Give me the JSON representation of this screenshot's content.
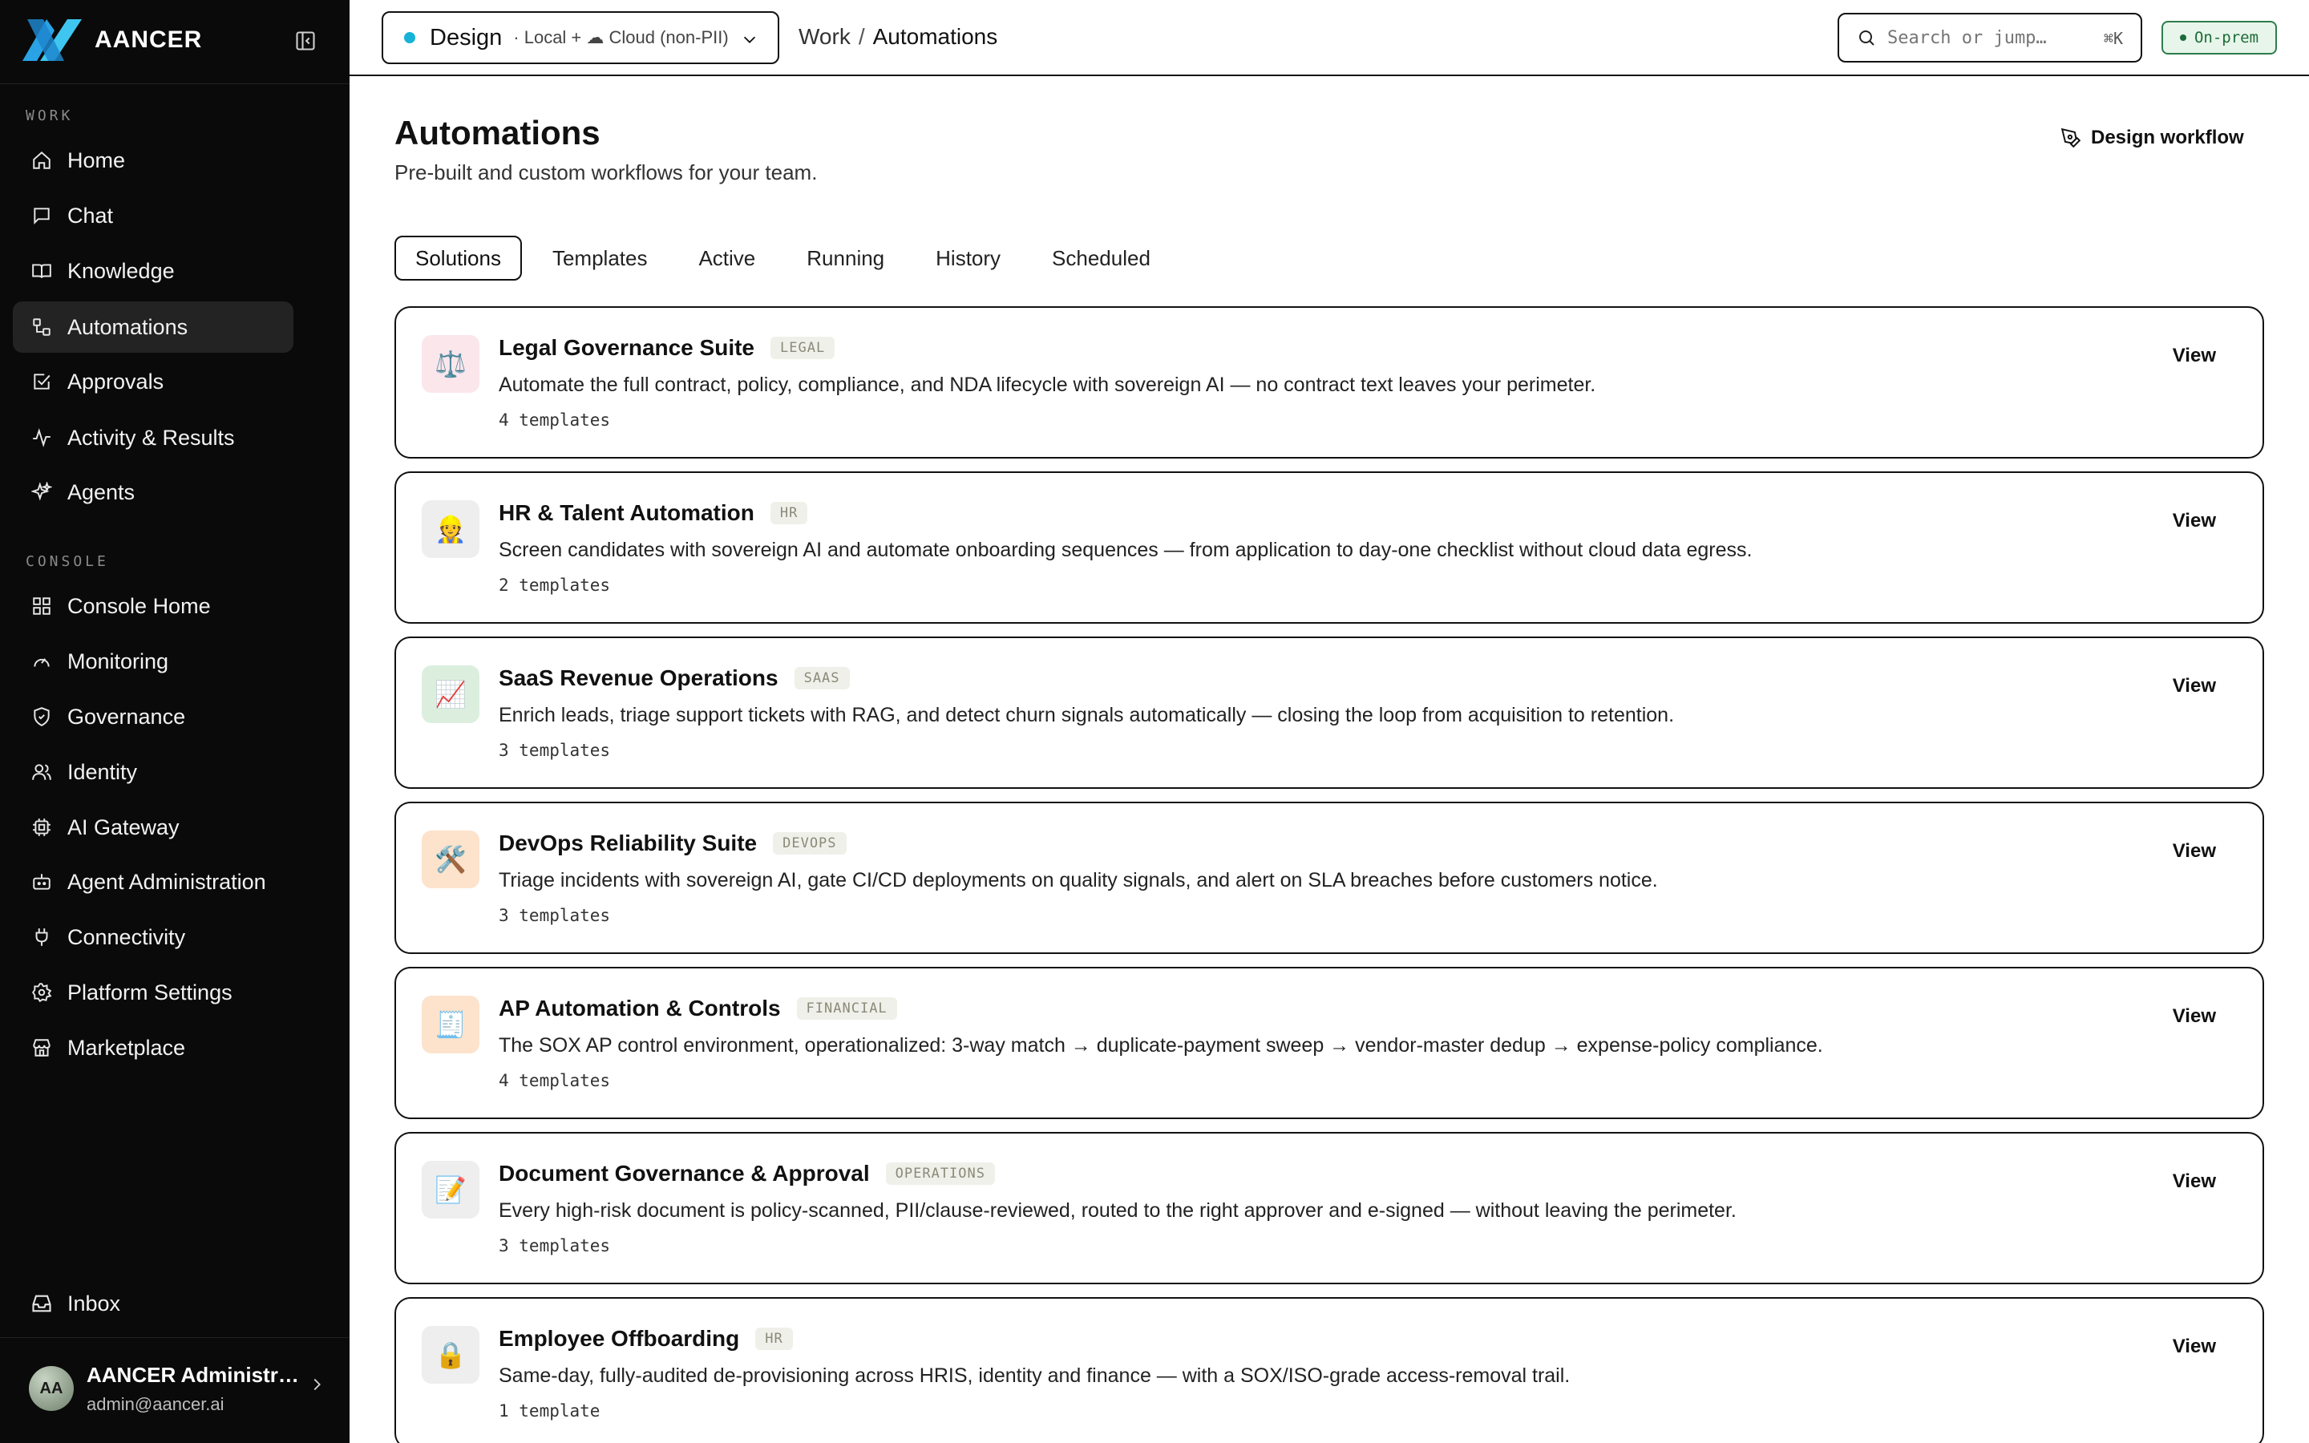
{
  "brand": {
    "name": "AANCER"
  },
  "sidebar": {
    "sections": {
      "work": "WORK",
      "console": "CONSOLE"
    },
    "work_items": [
      {
        "label": "Home",
        "icon": "home-icon"
      },
      {
        "label": "Chat",
        "icon": "chat-icon"
      },
      {
        "label": "Knowledge",
        "icon": "book-icon"
      },
      {
        "label": "Automations",
        "icon": "workflow-icon",
        "active": true
      },
      {
        "label": "Approvals",
        "icon": "check-square-icon"
      },
      {
        "label": "Activity & Results",
        "icon": "activity-icon"
      },
      {
        "label": "Agents",
        "icon": "sparkles-icon"
      }
    ],
    "console_items": [
      {
        "label": "Console Home",
        "icon": "grid-icon"
      },
      {
        "label": "Monitoring",
        "icon": "gauge-icon"
      },
      {
        "label": "Governance",
        "icon": "shield-icon"
      },
      {
        "label": "Identity",
        "icon": "users-icon"
      },
      {
        "label": "AI Gateway",
        "icon": "chip-icon"
      },
      {
        "label": "Agent Administration",
        "icon": "bot-icon"
      },
      {
        "label": "Connectivity",
        "icon": "plug-icon"
      },
      {
        "label": "Platform Settings",
        "icon": "gear-icon"
      },
      {
        "label": "Marketplace",
        "icon": "store-icon"
      }
    ],
    "inbox": "Inbox",
    "user": {
      "initials": "AA",
      "name": "AANCER Administr…",
      "email": "admin@aancer.ai"
    }
  },
  "topbar": {
    "workspace": {
      "name": "Design",
      "sub": "· Local + ☁ Cloud (non-PII)"
    },
    "breadcrumb": {
      "parent": "Work",
      "sep": "/",
      "current": "Automations"
    },
    "search": {
      "placeholder": "Search or jump…",
      "shortcut": "⌘K"
    },
    "badge": "On-prem"
  },
  "main": {
    "title": "Automations",
    "subtitle": "Pre-built and custom workflows for your team.",
    "design_button": "Design workflow",
    "tabs": [
      "Solutions",
      "Templates",
      "Active",
      "Running",
      "History",
      "Scheduled"
    ],
    "cards": [
      {
        "title": "Legal Governance Suite",
        "tag": "LEGAL",
        "icon": "⚖️",
        "icon_bg": "#fbe6ec",
        "desc": "Automate the full contract, policy, compliance, and NDA lifecycle with sovereign AI — no contract text leaves your perimeter.",
        "count": "4 templates",
        "action": "View"
      },
      {
        "title": "HR & Talent Automation",
        "tag": "HR",
        "icon": "👷",
        "icon_bg": "#eeeeee",
        "desc": "Screen candidates with sovereign AI and automate onboarding sequences — from application to day-one checklist without cloud data egress.",
        "count": "2 templates",
        "action": "View"
      },
      {
        "title": "SaaS Revenue Operations",
        "tag": "SAAS",
        "icon": "📈",
        "icon_bg": "#dcefdf",
        "desc": "Enrich leads, triage support tickets with RAG, and detect churn signals automatically — closing the loop from acquisition to retention.",
        "count": "3 templates",
        "action": "View"
      },
      {
        "title": "DevOps Reliability Suite",
        "tag": "DEVOPS",
        "icon": "🛠️",
        "icon_bg": "#fde3cc",
        "desc": "Triage incidents with sovereign AI, gate CI/CD deployments on quality signals, and alert on SLA breaches before customers notice.",
        "count": "3 templates",
        "action": "View"
      },
      {
        "title": "AP Automation & Controls",
        "tag": "FINANCIAL",
        "icon": "🧾",
        "icon_bg": "#fde3cc",
        "desc": "The SOX AP control environment, operationalized: 3-way match → duplicate-payment sweep → vendor-master dedup → expense-policy compliance.",
        "count": "4 templates",
        "action": "View"
      },
      {
        "title": "Document Governance & Approval",
        "tag": "OPERATIONS",
        "icon": "📝",
        "icon_bg": "#eeeeee",
        "desc": "Every high-risk document is policy-scanned, PII/clause-reviewed, routed to the right approver and e-signed — without leaving the perimeter.",
        "count": "3 templates",
        "action": "View"
      },
      {
        "title": "Employee Offboarding",
        "tag": "HR",
        "icon": "🔒",
        "icon_bg": "#eeeeee",
        "desc": "Same-day, fully-audited de-provisioning across HRIS, identity and finance — with a SOX/ISO-grade access-removal trail.",
        "count": "1 template",
        "action": "View"
      }
    ]
  }
}
